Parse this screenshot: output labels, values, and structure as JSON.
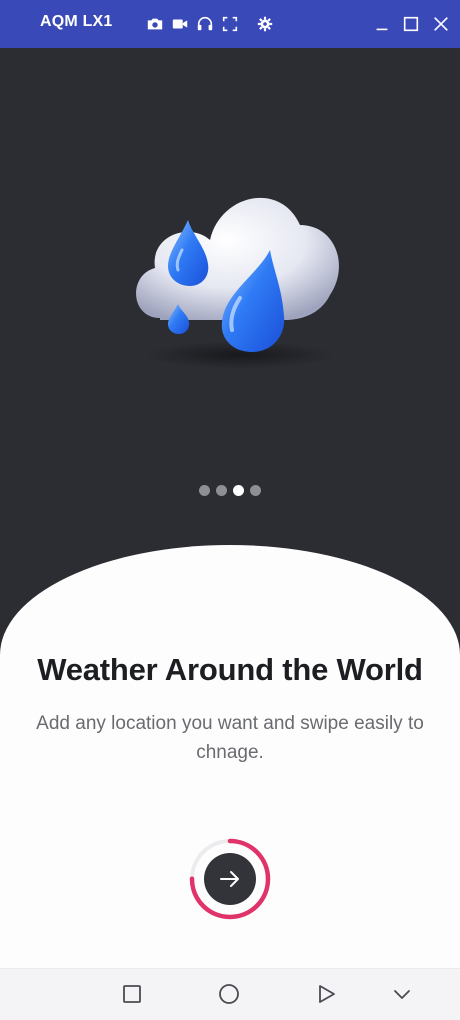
{
  "window": {
    "title": "AQM LX1",
    "toolbar_icons": [
      "camera-icon",
      "video-icon",
      "headphones-icon",
      "fullscreen-icon",
      "settings-icon"
    ],
    "controls": [
      "minimize-icon",
      "maximize-icon",
      "close-icon"
    ],
    "accent": "#3a49b8"
  },
  "onboarding": {
    "headline": "Weather Around the World",
    "subtitle": "Add any location you want and swipe easily to chnage.",
    "pager": {
      "total": 4,
      "active_index": 2
    },
    "progress_fraction": 0.75,
    "progress_color": "#e0336a",
    "next_button_icon": "arrow-right-icon"
  },
  "navbar": {
    "items": [
      "recents-square-icon",
      "home-circle-icon",
      "back-triangle-icon",
      "chevron-down-icon"
    ]
  }
}
